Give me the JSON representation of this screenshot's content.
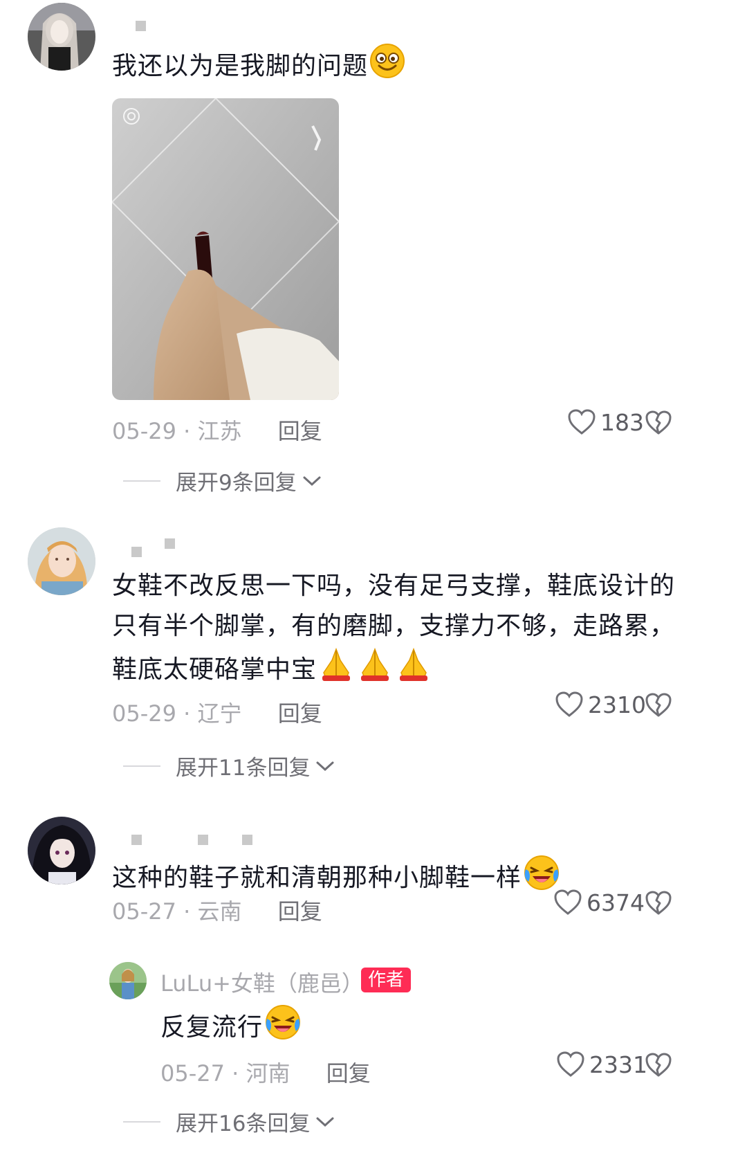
{
  "comments": [
    {
      "text": "我还以为是我脚的问题",
      "emoji": "smile-emoji",
      "date": "05-29",
      "location": "江苏",
      "reply_label": "回复",
      "likes": "183",
      "expand_label": "展开9条回复"
    },
    {
      "text_lines": [
        "女鞋不改反思一下吗，没有足弓支撑，鞋底设计的",
        "只有半个脚掌，有的磨脚，支撑力不够，走路累，",
        "鞋底太硬硌掌中宝"
      ],
      "emoji": "praying-hands-emoji",
      "date": "05-29",
      "location": "辽宁",
      "reply_label": "回复",
      "likes": "2310",
      "expand_label": "展开11条回复"
    },
    {
      "text": "这种的鞋子就和清朝那种小脚鞋一样",
      "emoji": "laughing-tears-emoji",
      "date": "05-27",
      "location": "云南",
      "reply_label": "回复",
      "likes": "6374",
      "sub_reply": {
        "author": "LuLu+女鞋（鹿邑）",
        "badge": "作者",
        "text": "反复流行",
        "emoji": "laughing-tears-emoji",
        "date": "05-27",
        "location": "河南",
        "reply_label": "回复",
        "likes": "2331"
      },
      "expand_label": "展开16条回复"
    }
  ],
  "separator": " · ",
  "colors": {
    "text": "#161823",
    "meta": "#a8a8ad",
    "badge": "#fe2c55"
  }
}
